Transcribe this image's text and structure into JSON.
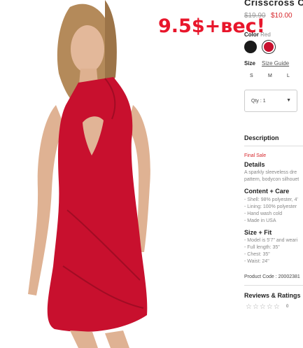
{
  "product": {
    "title": "Crisscross Cu",
    "price_old": "$19.90",
    "price_new": "$10.00",
    "color_label": "Color",
    "color_value": "Red",
    "swatches": [
      "#1a1a1a",
      "#c8102e"
    ],
    "size_label": "Size",
    "size_guide": "Size Guide",
    "sizes": [
      "S",
      "M",
      "L"
    ],
    "quantity": "Qty : 1"
  },
  "description": {
    "heading": "Description",
    "final_sale": "Final Sale",
    "details_heading": "Details",
    "details_lines": [
      "A sparkly sleeveless dre",
      "pattern, bodycon silhouet"
    ],
    "content_heading": "Content + Care",
    "content_lines": [
      "- Shell: 98% polyester, 4'",
      "- Lining: 100% polyester",
      "- Hand wash cold",
      "- Made in USA"
    ],
    "size_fit_heading": "Size + Fit",
    "size_fit_lines": [
      "- Model is 5'7\" and weari",
      "- Full length: 35\"",
      "- Chest: 35\"",
      "- Waist: 24\""
    ],
    "product_code": "Product Code : 20002381"
  },
  "reviews": {
    "heading": "Reviews & Ratings",
    "stars": "☆☆☆☆☆",
    "count": "0"
  },
  "overlay": {
    "text": "9.5$+вес!"
  },
  "colors": {
    "accent_red": "#d6262b",
    "dress_red": "#c8102e"
  }
}
